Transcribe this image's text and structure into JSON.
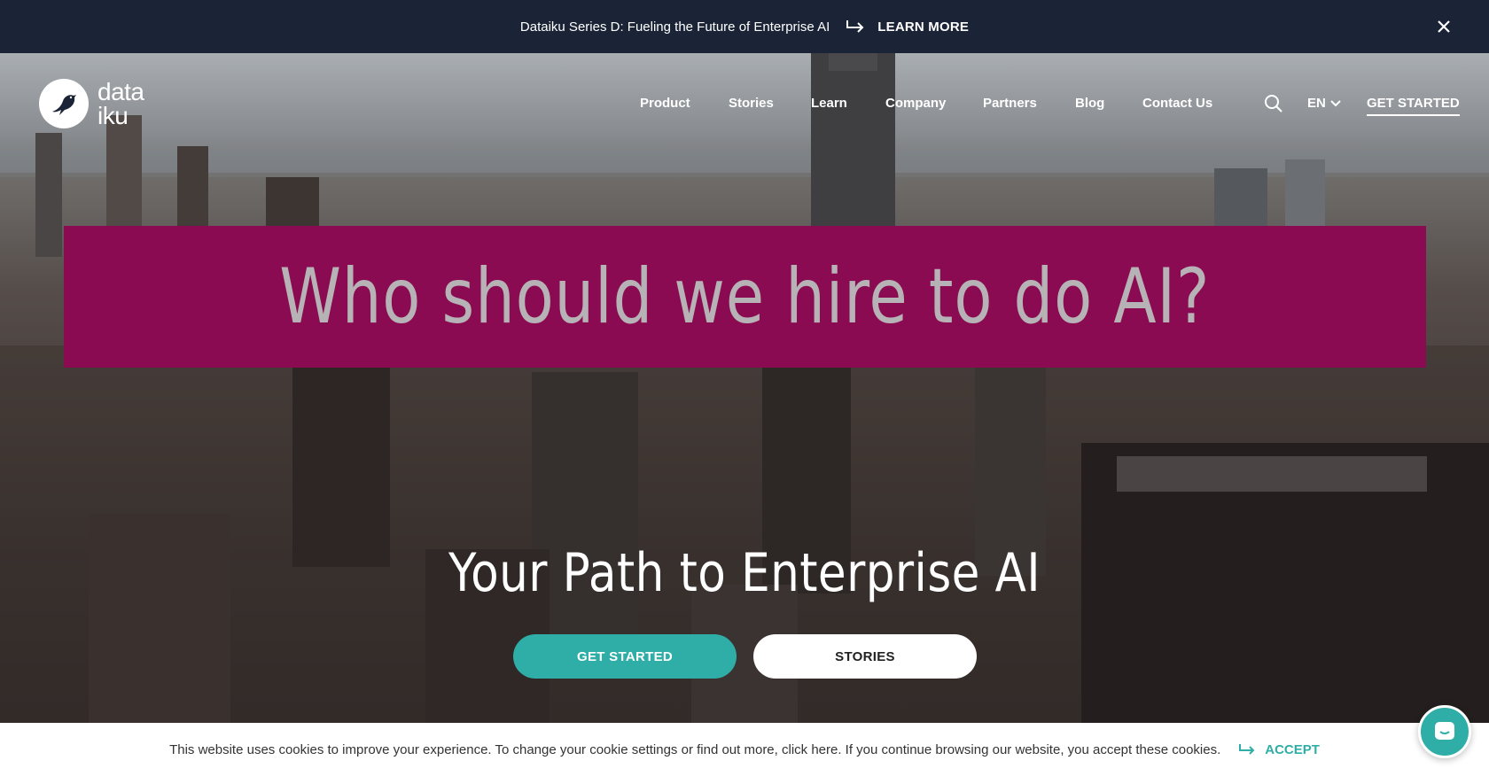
{
  "announcement": {
    "text": "Dataiku Series D: Fueling the Future of Enterprise AI",
    "link_label": "LEARN MORE",
    "arrow_icon": "return-arrow-icon",
    "close_icon": "close-icon"
  },
  "logo": {
    "line1": "data",
    "line2": "iku",
    "icon": "bird-icon"
  },
  "nav": {
    "items": [
      "Product",
      "Stories",
      "Learn",
      "Company",
      "Partners",
      "Blog",
      "Contact Us"
    ],
    "search_icon": "search-icon",
    "language": "EN",
    "cta": "GET STARTED"
  },
  "hero": {
    "video_caption": "Who should we hire to do AI?",
    "title": "Your Path to Enterprise AI",
    "primary_button": "GET STARTED",
    "secondary_button": "STORIES"
  },
  "cookie": {
    "message": "This website uses cookies to improve your experience. To change your cookie settings or find out more, click here. If you continue browsing our website, you accept these cookies.",
    "accept_label": "ACCEPT"
  },
  "chat": {
    "icon": "chat-icon"
  },
  "colors": {
    "announcement_bg": "#1b2437",
    "accent_teal": "#2fada7",
    "caption_magenta": "#8a0b52"
  }
}
